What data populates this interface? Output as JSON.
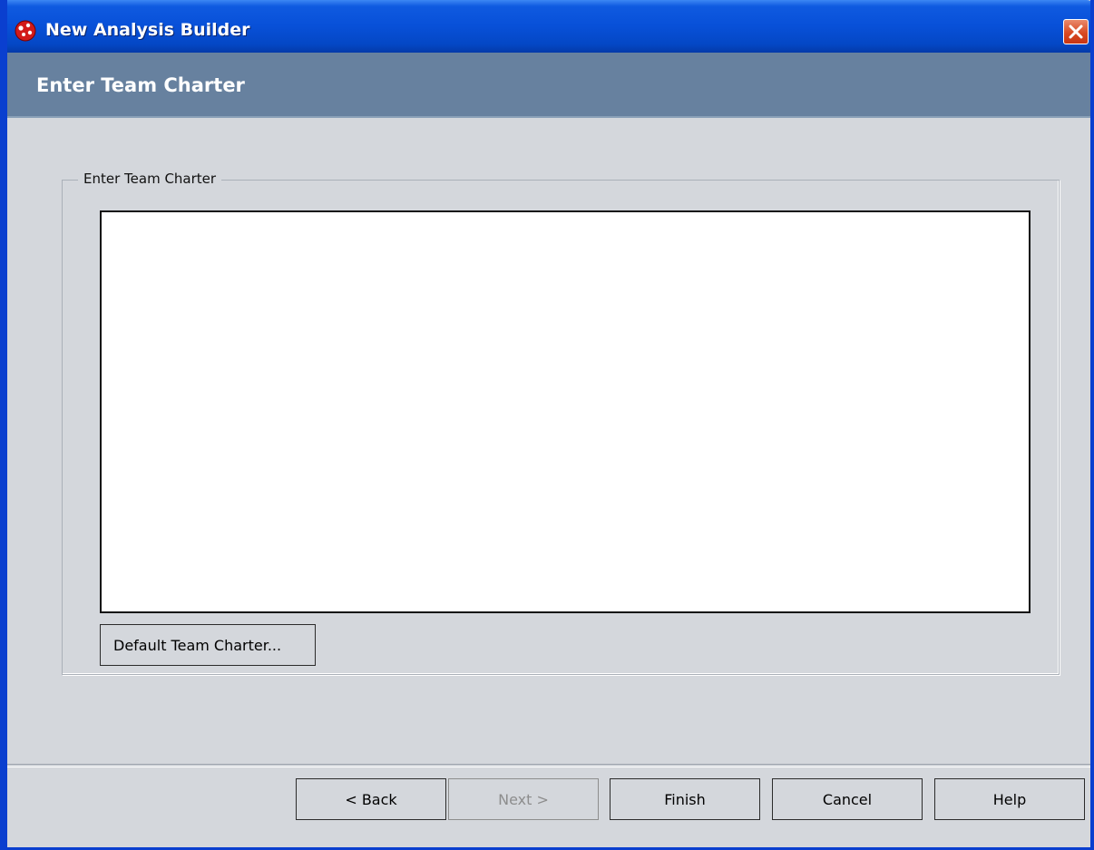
{
  "window": {
    "title": "New Analysis Builder"
  },
  "header": {
    "title": "Enter Team Charter"
  },
  "group": {
    "legend": "Enter Team Charter",
    "charter_value": "",
    "default_button_label": "Default Team Charter..."
  },
  "footer": {
    "back_label": "< Back",
    "next_label": "Next >",
    "finish_label": "Finish",
    "cancel_label": "Cancel",
    "help_label": "Help"
  },
  "colors": {
    "titlebar": "#0850d8",
    "header_band": "#67819f",
    "dialog_background": "#d4d7dc",
    "close_button": "#d84a23"
  },
  "icons": {
    "app": "red-molecule-icon",
    "close": "close-icon"
  }
}
